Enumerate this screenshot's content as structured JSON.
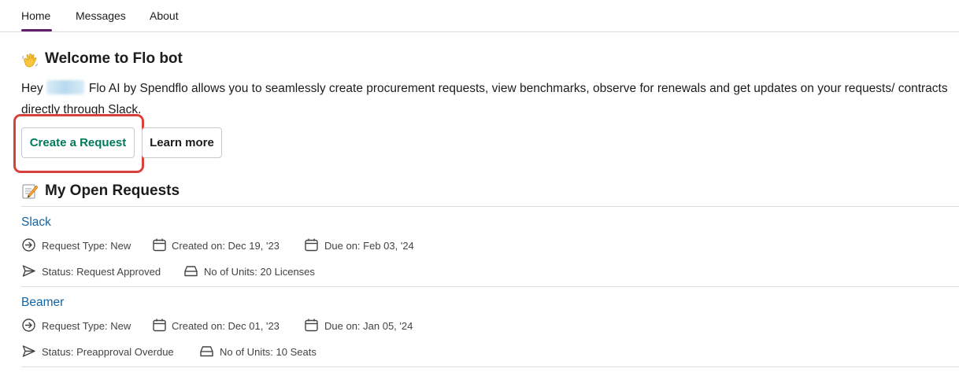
{
  "tabs": [
    {
      "label": "Home",
      "active": true
    },
    {
      "label": "Messages",
      "active": false
    },
    {
      "label": "About",
      "active": false
    }
  ],
  "welcome": {
    "emoji": "waving-hand-icon",
    "title": "Welcome to Flo bot",
    "greeting": "Hey",
    "description": "Flo AI by Spendflo allows you to seamlessly create procurement requests, view benchmarks, observe for renewals and get updates on your requests/ contracts directly through Slack."
  },
  "buttons": {
    "create": "Create a Request",
    "learn": "Learn more"
  },
  "open_requests": {
    "emoji": "memo-icon",
    "title": "My Open Requests",
    "items": [
      {
        "name": "Slack",
        "request_type": "Request Type: New",
        "created": "Created on: Dec 19, '23",
        "due": "Due on:  Feb 03, '24",
        "status": "Status: Request Approved",
        "units": "No of Units: 20 Licenses"
      },
      {
        "name": "Beamer",
        "request_type": "Request Type: New",
        "created": "Created on: Dec 01, '23",
        "due": "Due on:  Jan 05, '24",
        "status": "Status: Preapproval Overdue",
        "units": "No of Units: 10 Seats"
      }
    ]
  },
  "colors": {
    "accent_tab": "#611f69",
    "link": "#1264a3",
    "primary_button_text": "#007a5a",
    "highlight": "#d9423a"
  }
}
